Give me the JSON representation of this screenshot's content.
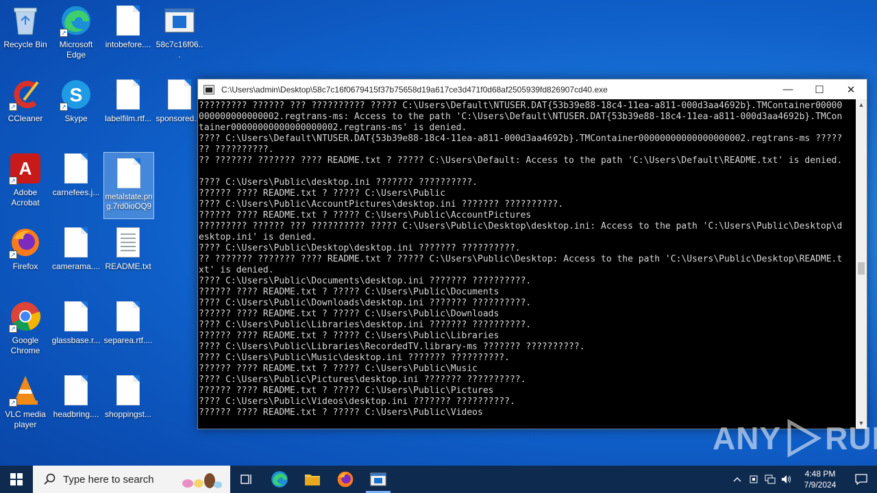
{
  "desktop": {
    "icons": [
      {
        "label": "Recycle Bin",
        "icon": "recycle-bin-icon"
      },
      {
        "label": "Microsoft Edge",
        "icon": "edge-icon"
      },
      {
        "label": "intobefore....",
        "icon": "file-icon"
      },
      {
        "label": "58c7c16f06...",
        "icon": "app-window-icon"
      },
      {
        "label": "CCleaner",
        "icon": "ccleaner-icon"
      },
      {
        "label": "Skype",
        "icon": "skype-icon"
      },
      {
        "label": "labelfilm.rtf...",
        "icon": "file-icon"
      },
      {
        "label": "sponsored....",
        "icon": "file-icon"
      },
      {
        "label": "Adobe Acrobat",
        "icon": "acrobat-icon"
      },
      {
        "label": "carnefees.j...",
        "icon": "file-icon"
      },
      {
        "label": "metalstate.png.7rd0ioOQ9",
        "icon": "file-icon"
      },
      {
        "label": "Firefox",
        "icon": "firefox-icon"
      },
      {
        "label": "camerama....",
        "icon": "file-icon"
      },
      {
        "label": "README.txt",
        "icon": "text-file-icon"
      },
      {
        "label": "Google Chrome",
        "icon": "chrome-icon"
      },
      {
        "label": "glassbase.r...",
        "icon": "file-icon"
      },
      {
        "label": "separea.rtf....",
        "icon": "file-icon"
      },
      {
        "label": "VLC media player",
        "icon": "vlc-icon"
      },
      {
        "label": "headbring....",
        "icon": "file-icon"
      },
      {
        "label": "shoppingst...",
        "icon": "file-icon"
      }
    ]
  },
  "console": {
    "title": "C:\\Users\\admin\\Desktop\\58c7c16f0679415f37b75658d19a617ce3d471f0d68af2505939fd826907cd40.exe",
    "minimize": "—",
    "maximize": "☐",
    "close": "✕",
    "lines": [
      "????????? ?????? ??? ?????????? ????? C:\\Users\\Default\\NTUSER.DAT{53b39e88-18c4-11ea-a811-000d3aa4692b}.TMContainer00000",
      "000000000000002.regtrans-ms: Access to the path 'C:\\Users\\Default\\NTUSER.DAT{53b39e88-18c4-11ea-a811-000d3aa4692b}.TMCon",
      "tainer00000000000000000002.regtrans-ms' is denied.",
      "???? C:\\Users\\Default\\NTUSER.DAT{53b39e88-18c4-11ea-a811-000d3aa4692b}.TMContainer00000000000000000002.regtrans-ms ?????",
      "?? ??????????.",
      "?? ??????? ??????? ???? README.txt ? ????? C:\\Users\\Default: Access to the path 'C:\\Users\\Default\\README.txt' is denied.",
      "",
      "???? C:\\Users\\Public\\desktop.ini ??????? ??????????.",
      "?????? ???? README.txt ? ????? C:\\Users\\Public",
      "???? C:\\Users\\Public\\AccountPictures\\desktop.ini ??????? ??????????.",
      "?????? ???? README.txt ? ????? C:\\Users\\Public\\AccountPictures",
      "????????? ?????? ??? ?????????? ????? C:\\Users\\Public\\Desktop\\desktop.ini: Access to the path 'C:\\Users\\Public\\Desktop\\d",
      "esktop.ini' is denied.",
      "???? C:\\Users\\Public\\Desktop\\desktop.ini ??????? ??????????.",
      "?? ??????? ??????? ???? README.txt ? ????? C:\\Users\\Public\\Desktop: Access to the path 'C:\\Users\\Public\\Desktop\\README.t",
      "xt' is denied.",
      "???? C:\\Users\\Public\\Documents\\desktop.ini ??????? ??????????.",
      "?????? ???? README.txt ? ????? C:\\Users\\Public\\Documents",
      "???? C:\\Users\\Public\\Downloads\\desktop.ini ??????? ??????????.",
      "?????? ???? README.txt ? ????? C:\\Users\\Public\\Downloads",
      "???? C:\\Users\\Public\\Libraries\\desktop.ini ??????? ??????????.",
      "?????? ???? README.txt ? ????? C:\\Users\\Public\\Libraries",
      "???? C:\\Users\\Public\\Libraries\\RecordedTV.library-ms ??????? ??????????.",
      "???? C:\\Users\\Public\\Music\\desktop.ini ??????? ??????????.",
      "?????? ???? README.txt ? ????? C:\\Users\\Public\\Music",
      "???? C:\\Users\\Public\\Pictures\\desktop.ini ??????? ??????????.",
      "?????? ???? README.txt ? ????? C:\\Users\\Public\\Pictures",
      "???? C:\\Users\\Public\\Videos\\desktop.ini ??????? ??????????.",
      "?????? ???? README.txt ? ????? C:\\Users\\Public\\Videos"
    ]
  },
  "watermark": {
    "left": "ANY",
    "right": "RUN"
  },
  "taskbar": {
    "search_placeholder": "Type here to search",
    "time": "4:48 PM",
    "date": "7/9/2024",
    "pinned": [
      "task-view-icon",
      "edge-icon",
      "file-explorer-icon",
      "firefox-icon",
      "console-app-icon"
    ]
  },
  "colors": {
    "accent": "#1a73d8",
    "taskbar": "#0e2a4f",
    "console_bg": "#000000",
    "console_text": "#d8d8d8"
  }
}
